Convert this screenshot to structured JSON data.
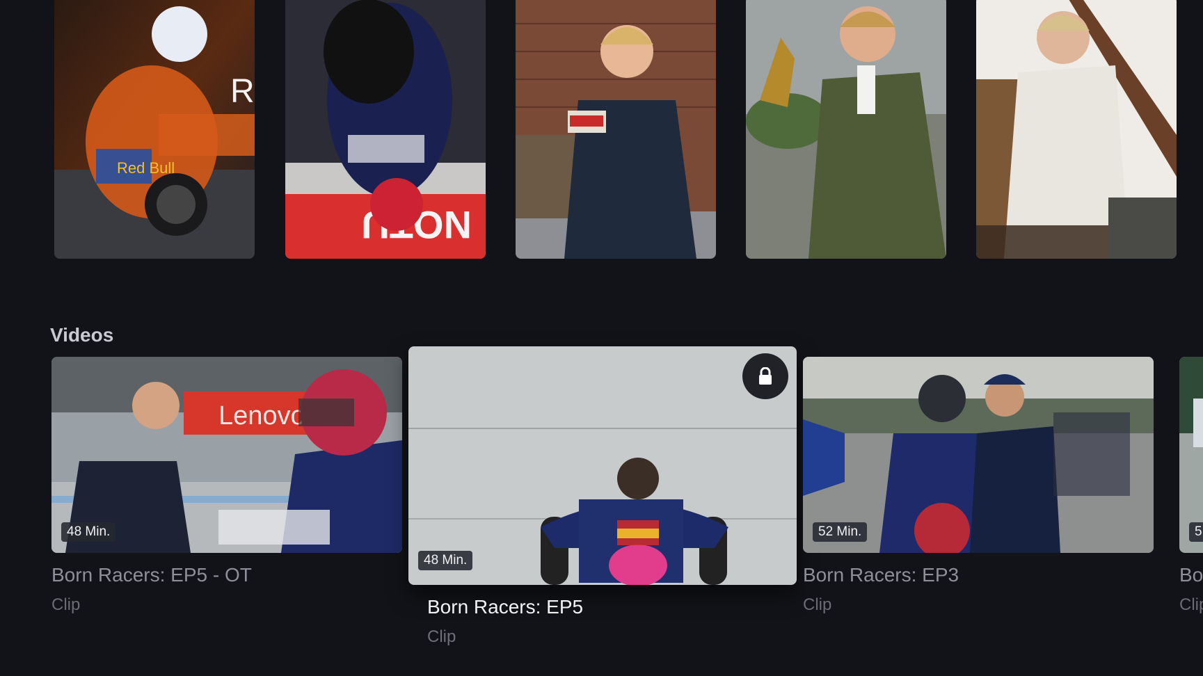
{
  "top_row": {
    "posters": [
      {
        "name": "poster-racer-orange",
        "overlay_text": "R"
      },
      {
        "name": "poster-racer-upside-down",
        "overlay_text": ""
      },
      {
        "name": "poster-host-bookshelf",
        "overlay_text": ""
      },
      {
        "name": "poster-man-green-jacket",
        "overlay_text": ""
      },
      {
        "name": "poster-man-attic",
        "overlay_text": ""
      }
    ]
  },
  "videos": {
    "section_title": "Videos",
    "items": [
      {
        "duration": "48 Min.",
        "title": "Born Racers: EP5 - OT",
        "subtitle": "Clip",
        "locked": false,
        "focused": false
      },
      {
        "duration": "48 Min.",
        "title": "Born Racers: EP5",
        "subtitle": "Clip",
        "locked": true,
        "focused": true
      },
      {
        "duration": "52 Min.",
        "title": "Born Racers: EP3",
        "subtitle": "Clip",
        "locked": false,
        "focused": false
      },
      {
        "duration": "5",
        "title": "Bo",
        "subtitle": "Clip",
        "locked": false,
        "focused": false
      }
    ]
  },
  "icons": {
    "lock": "lock-icon"
  },
  "colors": {
    "background": "#121318",
    "focused_title": "#f2f2f5",
    "dim_title": "#8f8f99"
  }
}
